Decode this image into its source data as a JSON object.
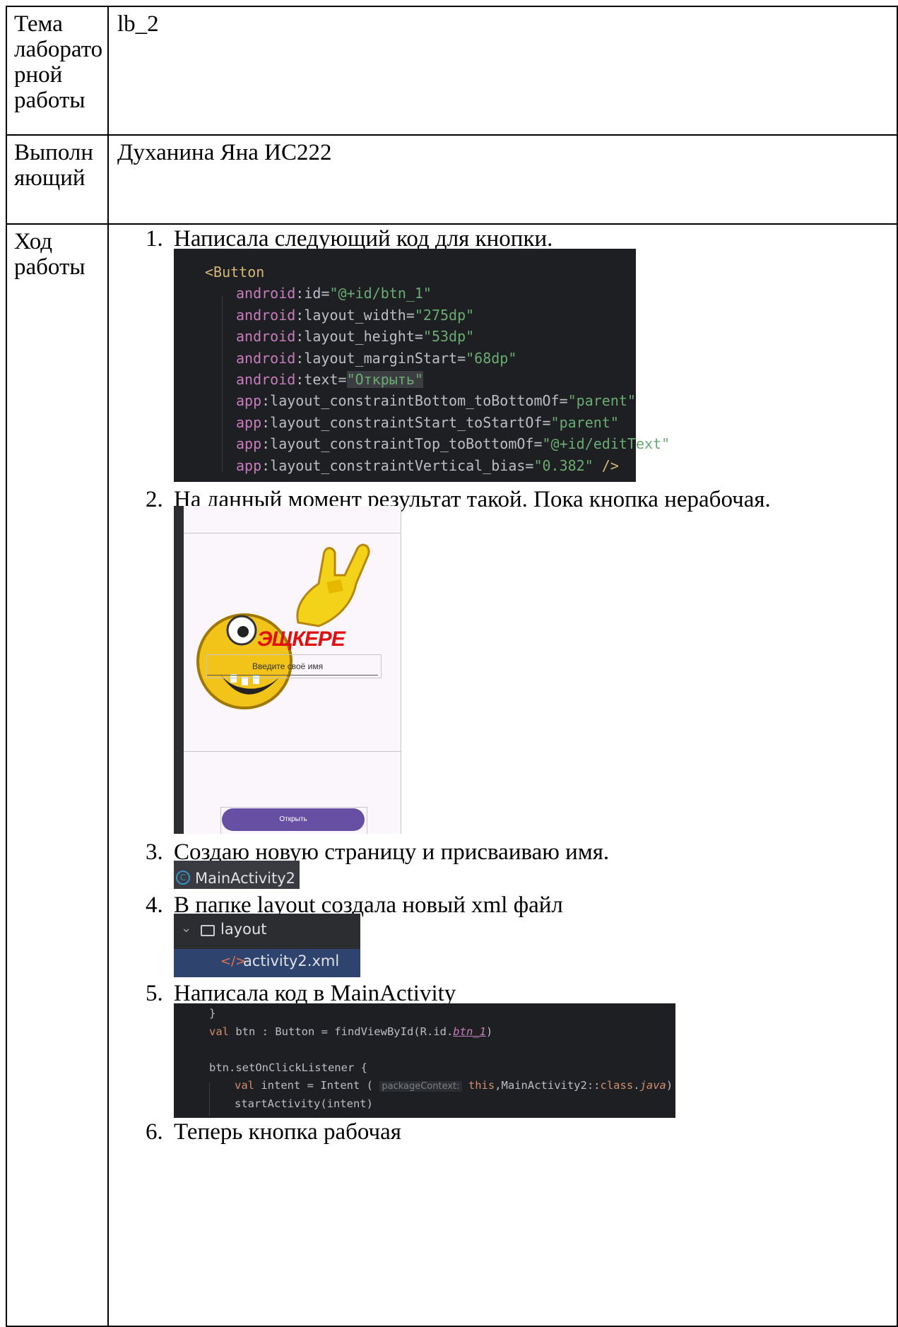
{
  "rows": [
    {
      "label": "Тема\nлаборато\nрной\nработы",
      "value": "lb_2"
    },
    {
      "label": "Выполн\nяющий",
      "value": "Духанина Яна ИС222"
    },
    {
      "label": "Ход\nработы"
    }
  ],
  "steps": [
    {
      "num": "1.",
      "text": "Написала следующий код для кнопки."
    },
    {
      "num": "2.",
      "text": "На данный момент результат такой. Пока кнопка нерабочая."
    },
    {
      "num": "3.",
      "text": "Создаю новую страницу и присваиваю имя."
    },
    {
      "num": "4.",
      "text": "В папке layout создала новый xml файл"
    },
    {
      "num": "5.",
      "text": "Написала код в MainActivity"
    },
    {
      "num": "6.",
      "text": "Теперь кнопка рабочая"
    }
  ],
  "code1": {
    "tag": "<Button",
    "lines": [
      {
        "ns": "android",
        "attr": "id",
        "value": "\"@+id/btn_1\""
      },
      {
        "ns": "android",
        "attr": "layout_width",
        "value": "\"275dp\""
      },
      {
        "ns": "android",
        "attr": "layout_height",
        "value": "\"53dp\""
      },
      {
        "ns": "android",
        "attr": "layout_marginStart",
        "value": "\"68dp\""
      },
      {
        "ns": "android",
        "attr": "text",
        "value": "\"Открыть\""
      },
      {
        "ns": "app",
        "attr": "layout_constraintBottom_toBottomOf",
        "value": "\"parent\""
      },
      {
        "ns": "app",
        "attr": "layout_constraintStart_toStartOf",
        "value": "\"parent\""
      },
      {
        "ns": "app",
        "attr": "layout_constraintTop_toBottomOf",
        "value": "\"@+id/editText\""
      },
      {
        "ns": "app",
        "attr": "layout_constraintVertical_bias",
        "value": "\"0.382\"",
        "close": " />"
      }
    ]
  },
  "phone": {
    "title": "ЭЩКЕРЕ",
    "edit_hint": "Введите своё имя",
    "button": "Открыть"
  },
  "class_chip": {
    "icon": "class-icon",
    "name": "MainActivity2"
  },
  "tree": {
    "folder": "layout",
    "file": "activity2.xml"
  },
  "code2": {
    "line1": "}",
    "val": "val",
    "decl": " btn : Button = findViewById(R.id.",
    "field": "btn_1",
    "close": ")",
    "listener": "btn.setOnClickListener {",
    "intent_pre": " intent = Intent ",
    "paren": "(",
    "hint": "packageContext:",
    "this": "this",
    "cls": ",MainActivity2::",
    "class_kw": "class",
    "dot": ".",
    "java": "java",
    "close2": ")",
    "start": "startActivity(intent)"
  },
  "colors": {
    "code_bg": "#1e1f22",
    "button": "#6750a4",
    "title_red": "#e01010"
  }
}
